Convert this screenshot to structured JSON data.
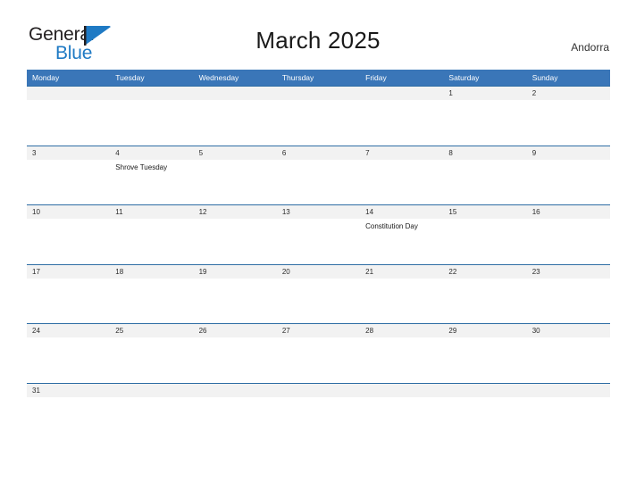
{
  "brand": {
    "name_part1": "General",
    "name_part2": "Blue",
    "mark": "triangle-flag",
    "color_dark": "#231f20",
    "color_blue": "#1f7ac4"
  },
  "header": {
    "title": "March 2025",
    "country": "Andorra"
  },
  "calendar": {
    "header_bg": "#3a76b8",
    "date_band_bg": "#f2f2f2",
    "rule_color": "#2e6da4",
    "weekdays": [
      "Monday",
      "Tuesday",
      "Wednesday",
      "Thursday",
      "Friday",
      "Saturday",
      "Sunday"
    ],
    "weeks": [
      {
        "dates": [
          "",
          "",
          "",
          "",
          "",
          "1",
          "2"
        ],
        "events": [
          "",
          "",
          "",
          "",
          "",
          "",
          ""
        ]
      },
      {
        "dates": [
          "3",
          "4",
          "5",
          "6",
          "7",
          "8",
          "9"
        ],
        "events": [
          "",
          "Shrove Tuesday",
          "",
          "",
          "",
          "",
          ""
        ]
      },
      {
        "dates": [
          "10",
          "11",
          "12",
          "13",
          "14",
          "15",
          "16"
        ],
        "events": [
          "",
          "",
          "",
          "",
          "Constitution Day",
          "",
          ""
        ]
      },
      {
        "dates": [
          "17",
          "18",
          "19",
          "20",
          "21",
          "22",
          "23"
        ],
        "events": [
          "",
          "",
          "",
          "",
          "",
          "",
          ""
        ]
      },
      {
        "dates": [
          "24",
          "25",
          "26",
          "27",
          "28",
          "29",
          "30"
        ],
        "events": [
          "",
          "",
          "",
          "",
          "",
          "",
          ""
        ]
      },
      {
        "dates": [
          "31",
          "",
          "",
          "",
          "",
          "",
          ""
        ],
        "events": [
          "",
          "",
          "",
          "",
          "",
          "",
          ""
        ]
      }
    ]
  }
}
